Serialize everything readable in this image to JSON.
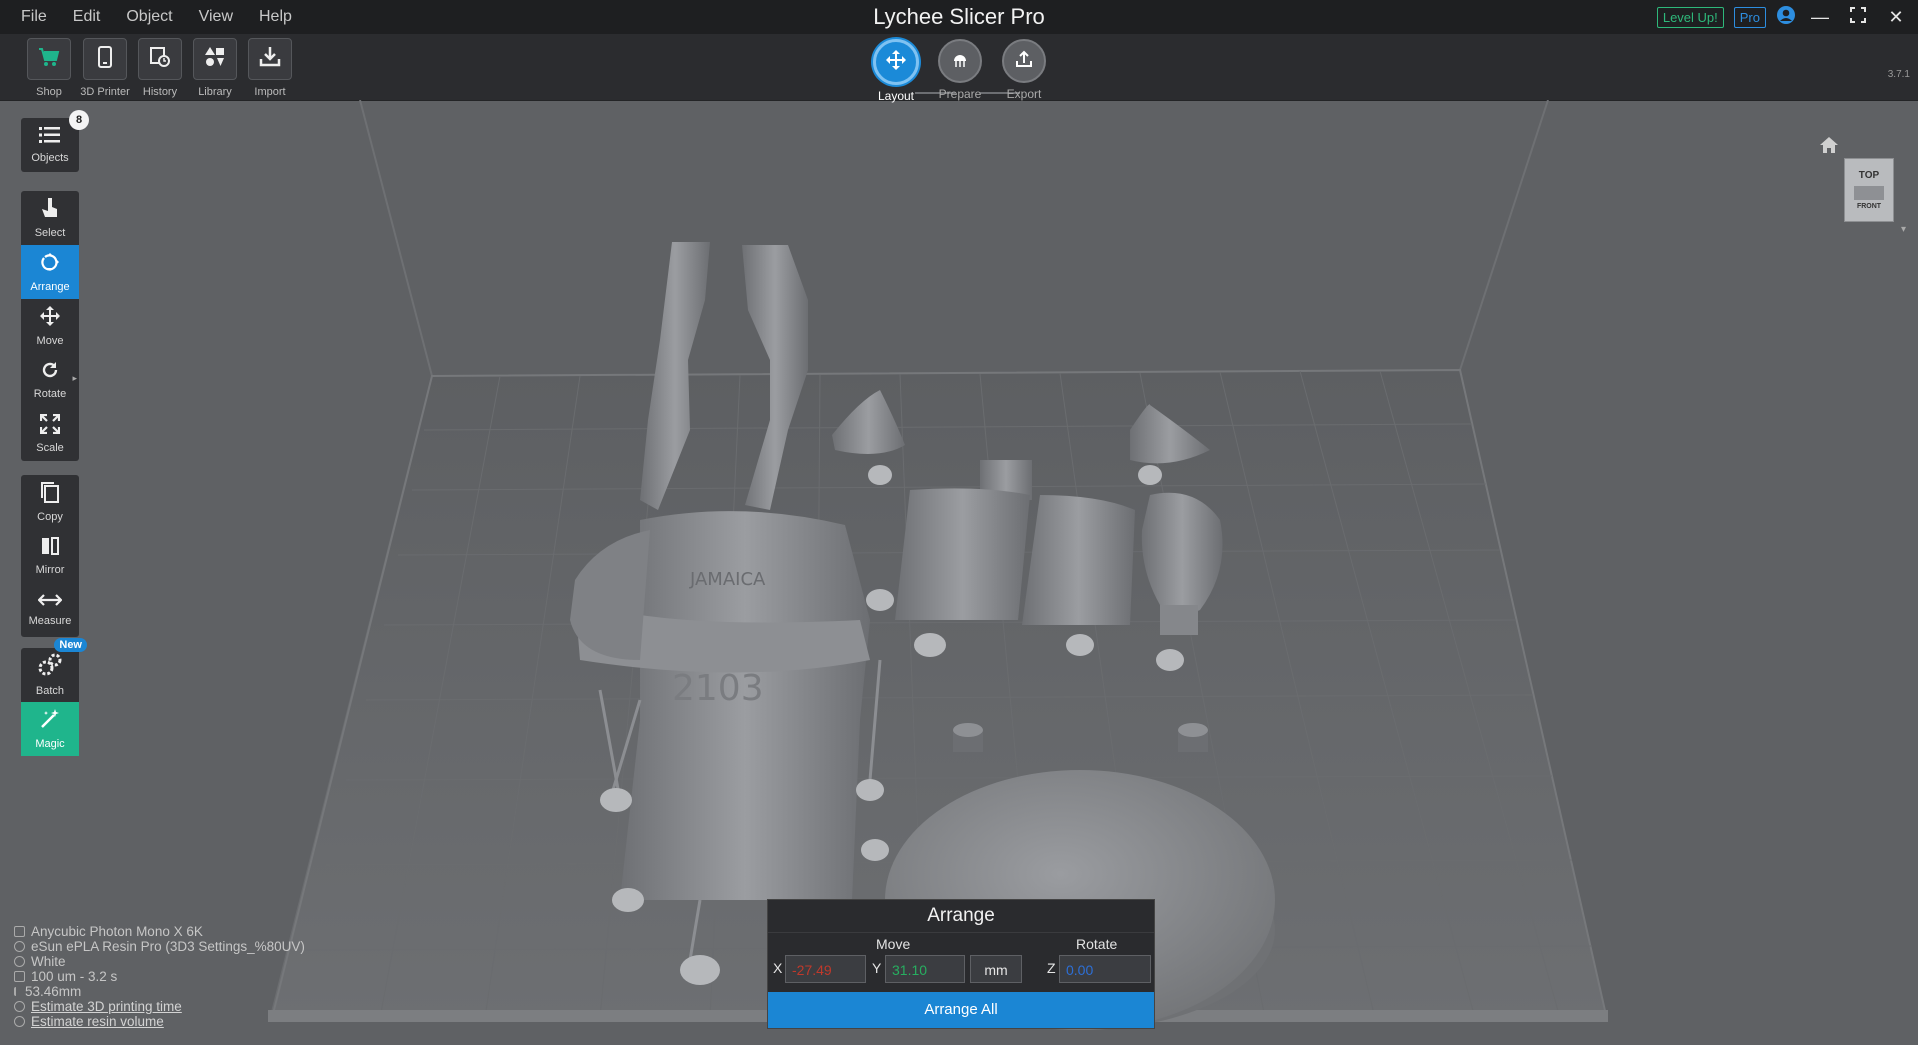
{
  "window": {
    "title": "Lychee Slicer Pro",
    "menu": [
      "File",
      "Edit",
      "Object",
      "View",
      "Help"
    ],
    "level_up": "Level Up!",
    "pro": "Pro",
    "version": "3.7.1"
  },
  "toolbar": {
    "shop": "Shop",
    "printer": "3D Printer",
    "history": "History",
    "library": "Library",
    "import": "Import"
  },
  "workflow": {
    "layout": "Layout",
    "prepare": "Prepare",
    "export": "Export"
  },
  "left_tools": {
    "objects": "Objects",
    "objects_count": "8",
    "select": "Select",
    "arrange": "Arrange",
    "move": "Move",
    "rotate": "Rotate",
    "scale": "Scale",
    "copy": "Copy",
    "mirror": "Mirror",
    "measure": "Measure",
    "batch": "Batch",
    "batch_badge": "New",
    "magic": "Magic"
  },
  "viewcube": {
    "top": "TOP",
    "front": "FRONT"
  },
  "status": {
    "printer": "Anycubic Photon Mono X 6K",
    "resin": "eSun ePLA Resin Pro (3D3 Settings_%80UV)",
    "color": "White",
    "layer": "100 um - 3.2 s",
    "height": "53.46mm",
    "estimate_time": "Estimate 3D printing time",
    "estimate_volume": "Estimate resin volume"
  },
  "arrange_panel": {
    "title": "Arrange",
    "move_label": "Move",
    "rotate_label": "Rotate",
    "x_label": "X",
    "y_label": "Y",
    "z_label": "Z",
    "x_value": "-27.49",
    "y_value": "31.10",
    "unit": "mm",
    "z_value": "0.00",
    "button": "Arrange All"
  },
  "colors": {
    "accent_blue": "#1b86d4",
    "magic_green": "#1fb58c",
    "x_red": "#c0392b",
    "y_green": "#27ae60",
    "z_blue": "#2d6fd6"
  }
}
